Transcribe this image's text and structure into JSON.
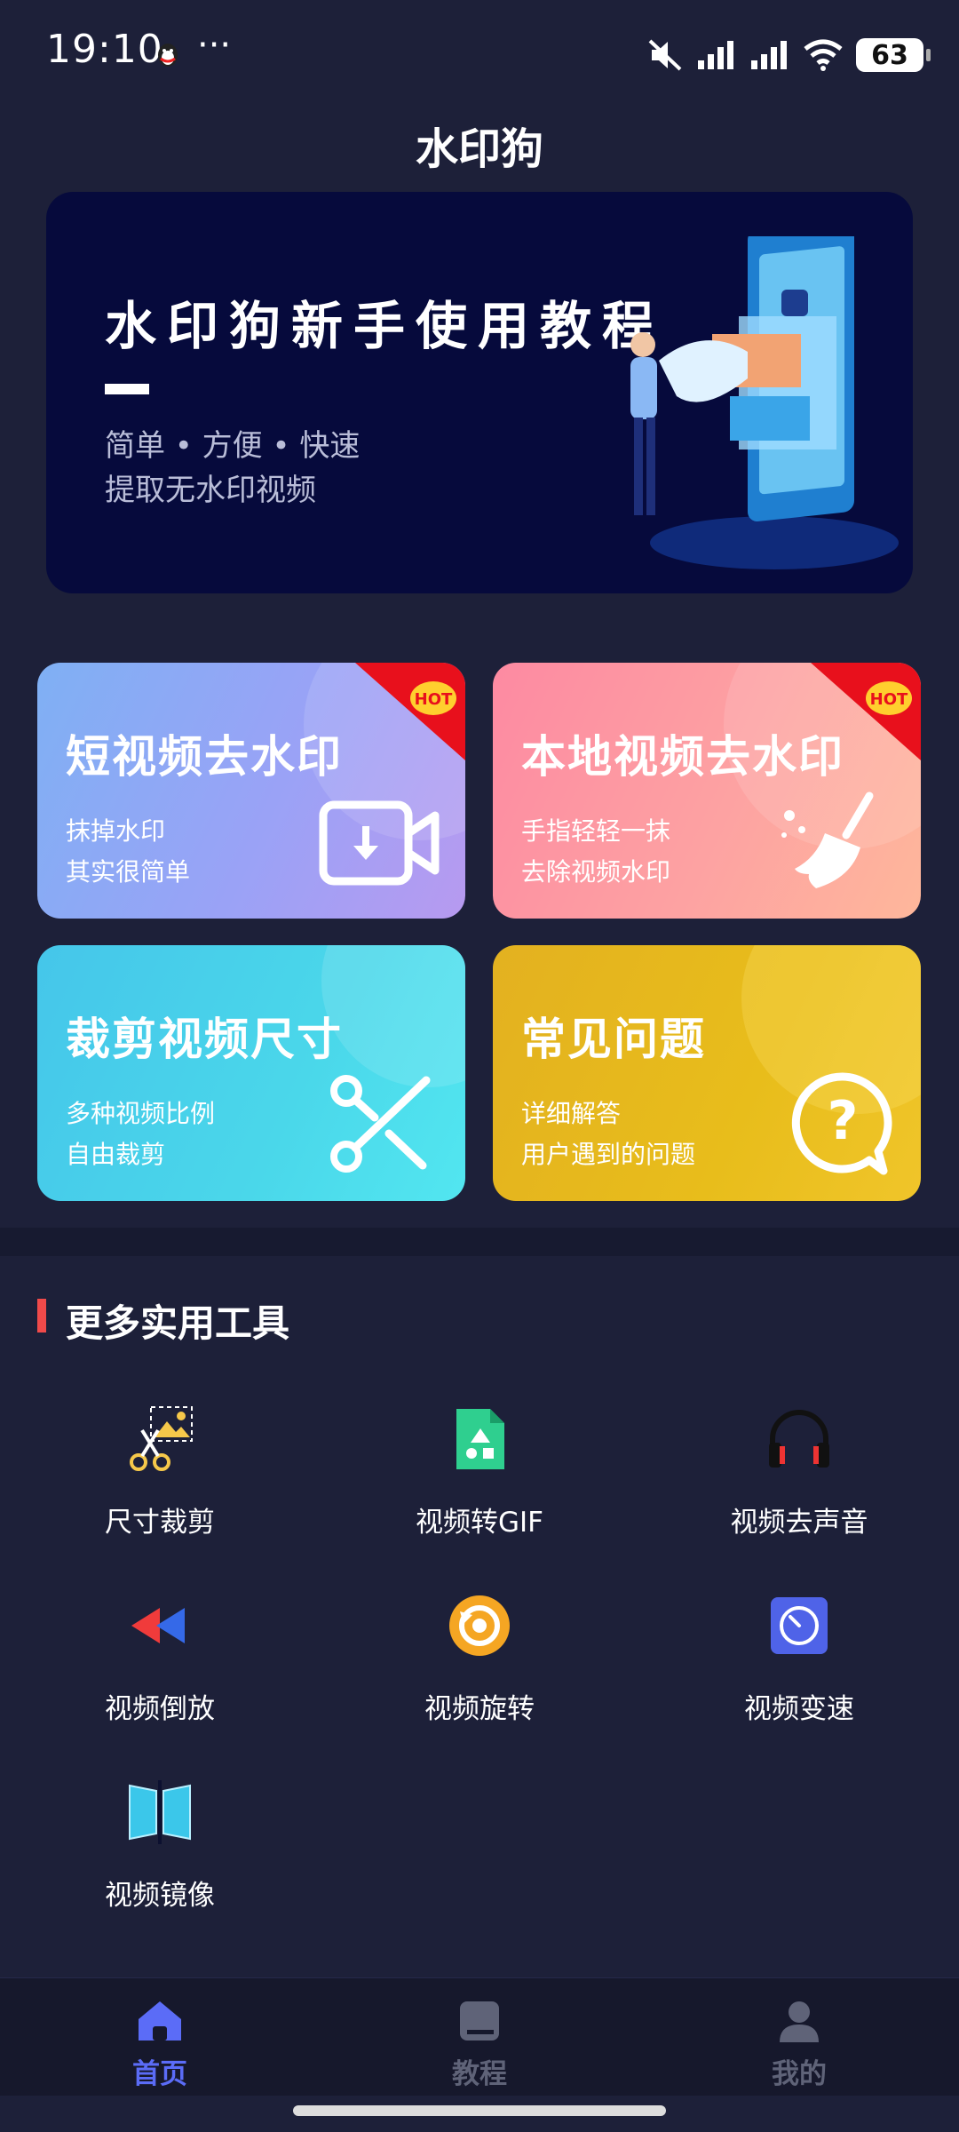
{
  "status_bar": {
    "time": "19:10",
    "dots": "···",
    "battery": "63"
  },
  "app": {
    "title": "水印狗"
  },
  "banner": {
    "title": "水印狗新手使用教程",
    "subtitle_line1": "简单 • 方便 • 快速",
    "subtitle_line2": "提取无水印视频"
  },
  "cards": [
    {
      "title": "短视频去水印",
      "line1": "抹掉水印",
      "line2": "其实很简单",
      "badge": "HOT",
      "icon": "video-download-icon"
    },
    {
      "title": "本地视频去水印",
      "line1": "手指轻轻一抹",
      "line2": "去除视频水印",
      "badge": "HOT",
      "icon": "broom-icon"
    },
    {
      "title": "裁剪视频尺寸",
      "line1": "多种视频比例",
      "line2": "自由裁剪",
      "icon": "scissors-icon"
    },
    {
      "title": "常见问题",
      "line1": "详细解答",
      "line2": "用户遇到的问题",
      "icon": "question-bubble-icon"
    }
  ],
  "tools_section": {
    "title": "更多实用工具",
    "items": [
      {
        "label": "尺寸裁剪",
        "icon": "crop-scissors-icon"
      },
      {
        "label": "视频转GIF",
        "icon": "gif-file-icon"
      },
      {
        "label": "视频去声音",
        "icon": "headphones-icon"
      },
      {
        "label": "视频倒放",
        "icon": "rewind-icon"
      },
      {
        "label": "视频旋转",
        "icon": "rotate-icon"
      },
      {
        "label": "视频变速",
        "icon": "speed-gauge-icon"
      },
      {
        "label": "视频镜像",
        "icon": "mirror-icon"
      }
    ]
  },
  "bottom_nav": [
    {
      "label": "首页",
      "icon": "home-icon",
      "active": true
    },
    {
      "label": "教程",
      "icon": "book-icon",
      "active": false
    },
    {
      "label": "我的",
      "icon": "user-icon",
      "active": false
    }
  ],
  "colors": {
    "background": "#1d2039",
    "banner": "#060a3c",
    "accent_active": "#5b6cf7",
    "nav_inactive": "#5f6378",
    "hot_badge": "#e8101c",
    "section_bar": "#f04a4a"
  }
}
